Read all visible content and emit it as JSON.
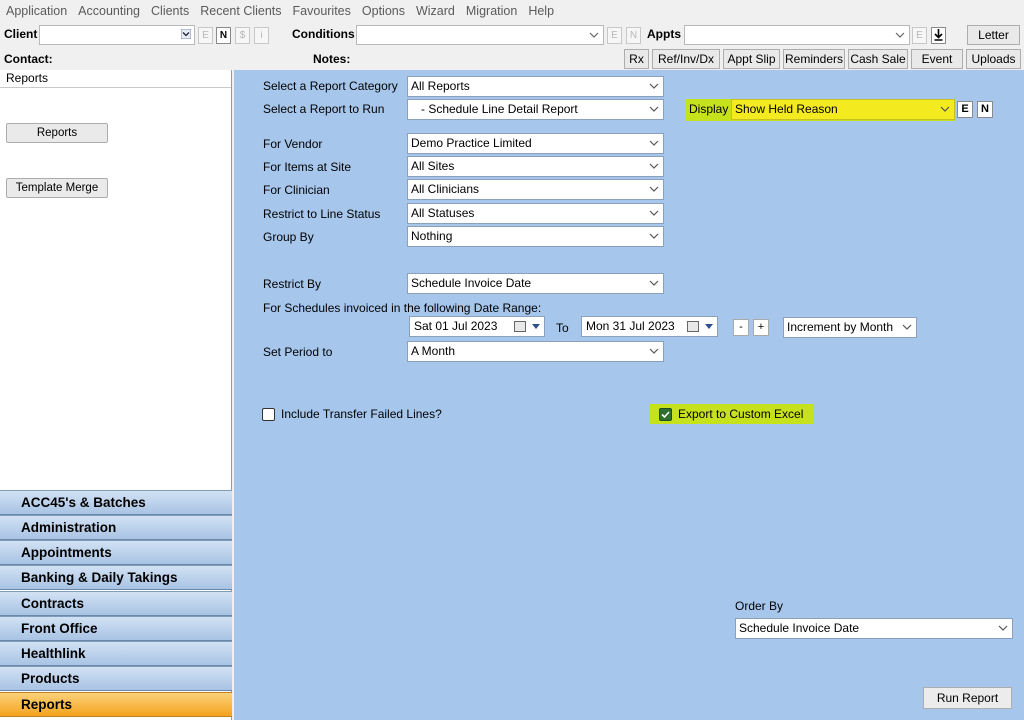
{
  "menu": [
    "Application",
    "Accounting",
    "Clients",
    "Recent Clients",
    "Favourites",
    "Options",
    "Wizard",
    "Migration",
    "Help"
  ],
  "toolbar": {
    "client_label": "Client",
    "client_value": "",
    "client_buttons": [
      "E",
      "N",
      "$",
      "i"
    ],
    "conditions_label": "Conditions",
    "conditions_value": "",
    "conditions_buttons": [
      "E",
      "N"
    ],
    "appts_label": "Appts",
    "appts_value": "",
    "appts_buttons": [
      "E"
    ],
    "letter_label": "Letter",
    "contact_label": "Contact:",
    "notes_label": "Notes:",
    "action_buttons": [
      "Rx",
      "Ref/Inv/Dx",
      "Appt Slip",
      "Reminders",
      "Cash Sale",
      "Event",
      "Uploads"
    ]
  },
  "left": {
    "header": "Reports",
    "reports_button": "Reports",
    "template_button": "Template Merge",
    "nav": [
      "ACC45's & Batches",
      "Administration",
      "Appointments",
      "Banking & Daily Takings",
      "Contracts",
      "Front Office",
      "Healthlink",
      "Products",
      "Reports"
    ],
    "active_nav": "Reports"
  },
  "form": {
    "category_label": "Select a Report Category",
    "category_value": "All Reports",
    "report_label": "Select a Report to Run",
    "report_value": "- Schedule Line Detail Report",
    "display_label": "Display",
    "display_value": "Show Held Reason",
    "display_buttons": [
      "E",
      "N"
    ],
    "vendor_label": "For Vendor",
    "vendor_value": "Demo Practice Limited",
    "site_label": "For Items at Site",
    "site_value": "All Sites",
    "clinician_label": "For Clinician",
    "clinician_value": "All Clinicians",
    "status_label": "Restrict to Line Status",
    "status_value": "All Statuses",
    "group_label": "Group By",
    "group_value": "Nothing",
    "restrict_label": "Restrict By",
    "restrict_value": "Schedule Invoice Date",
    "range_label": "For Schedules invoiced in the following Date Range:",
    "date_from": "Sat  01  Jul  2023",
    "to_label": "To",
    "date_to": "Mon 31  Jul  2023",
    "minus_label": "-",
    "plus_label": "+",
    "increment_value": "Increment by Month",
    "period_label": "Set Period to",
    "period_value": "A Month",
    "transfer_label": "Include Transfer Failed Lines?",
    "transfer_checked": false,
    "export_label": "Export to Custom Excel",
    "export_checked": true,
    "orderby_label": "Order By",
    "orderby_value": "Schedule Invoice Date",
    "run_button": "Run Report"
  },
  "colors": {
    "panel_bg": "#a6c6ec",
    "highlight": "#c6e21c",
    "active_nav": "#f4a21d"
  }
}
